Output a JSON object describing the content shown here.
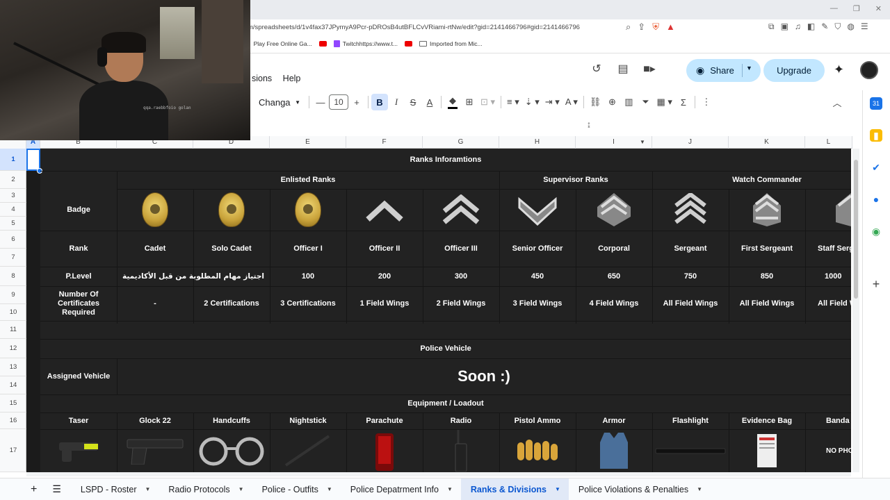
{
  "browser": {
    "url": "m/spreadsheets/d/1v4fax37JPymyA9Pcr-pDROsB4utBFLCvVRiami-rtNw/edit?gid=2141466796#gid=2141466796",
    "bookmarks": [
      "Play Free Online Ga...",
      "Twitchhttps://www.t...",
      "Imported from Mic..."
    ]
  },
  "sheets": {
    "menu_partial": "sions",
    "menu_help": "Help",
    "share_label": "Share",
    "upgrade_label": "Upgrade",
    "font_name": "Changa",
    "font_size": "10"
  },
  "grid": {
    "columns": [
      "A",
      "B",
      "C",
      "D",
      "E",
      "F",
      "G",
      "H",
      "I",
      "J",
      "K",
      "L"
    ],
    "rows": [
      "1",
      "2",
      "3",
      "4",
      "5",
      "6",
      "7",
      "8",
      "9",
      "10",
      "11",
      "12",
      "13",
      "14",
      "15",
      "16",
      "17"
    ],
    "title": "Ranks Inforamtions",
    "groups": {
      "enlisted": "Enlisted Ranks",
      "supervisor": "Supervisor Ranks",
      "watch": "Watch Commander"
    },
    "labels": {
      "badge": "Badge",
      "rank": "Rank",
      "plevel": "P.Level",
      "certs": "Number Of Certificates Required",
      "vehicle": "Assigned Vehicle"
    },
    "ranks": [
      "Cadet",
      "Solo Cadet",
      "Officer I",
      "Officer II",
      "Officer III",
      "Senior Officer",
      "Corporal",
      "Sergeant",
      "First Sergeant",
      "Staff Serg"
    ],
    "plevels": [
      "اجتياز مهام المطلوبة من قبل الأكاديمية",
      "100",
      "200",
      "300",
      "450",
      "650",
      "750",
      "850",
      "1000"
    ],
    "certs": [
      "-",
      "2 Certifications",
      "3 Certifications",
      "1 Field Wings",
      "2 Field Wings",
      "3 Field Wings",
      "4 Field Wings",
      "All Field Wings",
      "All Field Wings",
      "All Field W"
    ],
    "police_vehicle": "Police Vehicle",
    "soon": "Soon :)",
    "equipment_title": "Equipment / Loadout",
    "equipment": [
      "Taser",
      "Glock 22",
      "Handcuffs",
      "Nightstick",
      "Parachute",
      "Radio",
      "Pistol Ammo",
      "Armor",
      "Flashlight",
      "Evidence Bag",
      "Banda"
    ],
    "no_photo": "NO PHO"
  },
  "tabs": [
    "LSPD - Roster",
    "Radio Protocols",
    "Police - Outfits",
    "Police Depatrment Info",
    "Ranks & Divisions",
    "Police Violations & Penalties"
  ],
  "active_tab_index": 4,
  "webcam_caption": "qqa.raebbfoio golan"
}
